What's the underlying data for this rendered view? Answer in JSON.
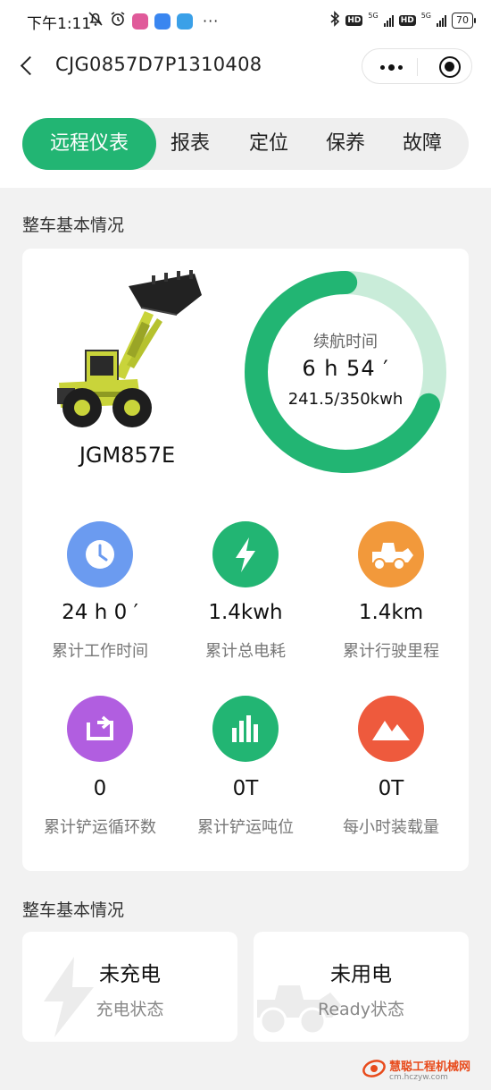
{
  "status_bar": {
    "time": "下午1:11",
    "network1": "5G",
    "network2": "5G",
    "hd": "HD",
    "battery": "70"
  },
  "nav": {
    "title": "CJG0857D7P1310408"
  },
  "tabs": [
    {
      "label": "远程仪表",
      "active": true
    },
    {
      "label": "报表",
      "active": false
    },
    {
      "label": "定位",
      "active": false
    },
    {
      "label": "保养",
      "active": false
    },
    {
      "label": "故障",
      "active": false
    }
  ],
  "section1": {
    "title": "整车基本情况"
  },
  "vehicle": {
    "model": "JGM857E"
  },
  "gauge": {
    "label": "续航时间",
    "value": "6 h 54 ′",
    "energy": "241.5/350kwh",
    "fraction": 0.69,
    "color_fill": "#22b573",
    "color_track": "#c9ecd9"
  },
  "stats": [
    {
      "value": "24 h 0 ′",
      "label": "累计工作时间",
      "icon": "clock-icon",
      "color": "#6b9bf0"
    },
    {
      "value": "1.4kwh",
      "label": "累计总电耗",
      "icon": "lightning-icon",
      "color": "#22b573"
    },
    {
      "value": "1.4km",
      "label": "累计行驶里程",
      "icon": "loader-icon",
      "color": "#f2993b"
    },
    {
      "value": "0",
      "label": "累计铲运循环数",
      "icon": "cycle-icon",
      "color": "#b15ee0"
    },
    {
      "value": "0T",
      "label": "累计铲运吨位",
      "icon": "bar-chart-icon",
      "color": "#22b573"
    },
    {
      "value": "0T",
      "label": "每小时装载量",
      "icon": "mountain-icon",
      "color": "#ee5a3d"
    }
  ],
  "section2": {
    "title": "整车基本情况"
  },
  "cards": [
    {
      "title": "未充电",
      "subtitle": "充电状态",
      "icon": "lightning-icon"
    },
    {
      "title": "未用电",
      "subtitle": "Ready状态",
      "icon": "loader-icon"
    }
  ],
  "watermark": {
    "name": "慧聪工程机械网",
    "url": "cm.hczyw.com"
  }
}
